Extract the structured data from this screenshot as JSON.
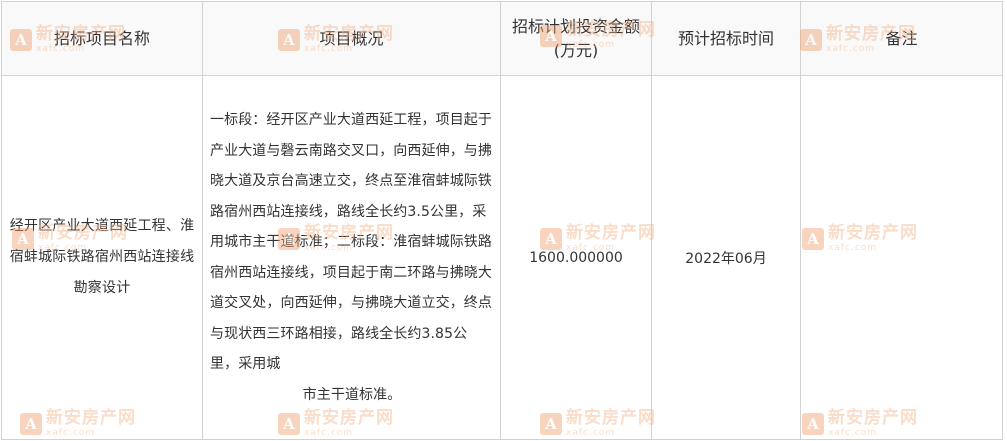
{
  "table": {
    "headers": {
      "project_name": "招标项目名称",
      "overview": "项目概况",
      "investment": "招标计划投资金额(万元)",
      "time": "预计招标时间",
      "remark": "备注"
    },
    "rows": [
      {
        "project_name": "经开区产业大道西延工程、淮宿蚌城际铁路宿州西站连接线勘察设计",
        "overview_main": "一标段：经开区产业大道西延工程，项目起于产业大道与磬云南路交叉口，向西延伸，与拂晓大道及京台高速立交，终点至淮宿蚌城际铁路宿州西站连接线，路线全长约3.5公里，采用城市主干道标准；二标段：淮宿蚌城际铁路宿州西站连接线，项目起于南二环路与拂晓大道交叉处，向西延伸，与拂晓大道立交，终点与现状西三环路相接，路线全长约3.85公里，采用城",
        "overview_end": "市主干道标准。",
        "investment": "1600.000000",
        "time": "2022年06月",
        "remark": ""
      }
    ]
  },
  "watermark": {
    "logo_letter": "A",
    "name": "新安房产网",
    "domain": "xafc.com",
    "color": "#f3b48a"
  }
}
